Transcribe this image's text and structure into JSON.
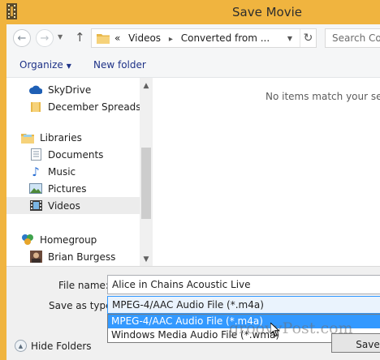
{
  "window": {
    "title": "Save Movie",
    "accent": "#f0b43f"
  },
  "navigation": {
    "back_icon": "back-arrow-icon",
    "forward_icon": "forward-arrow-icon",
    "up_icon": "up-arrow-icon"
  },
  "address": {
    "prefix": "«",
    "crumbs": [
      "Videos",
      "Converted from ..."
    ]
  },
  "search": {
    "placeholder": "Search Con"
  },
  "commands": {
    "organize": "Organize",
    "new_folder": "New folder"
  },
  "tree": {
    "items": [
      {
        "label": "SkyDrive",
        "icon": "skydrive-icon"
      },
      {
        "label": "December Spreadsheet",
        "icon": "folder-icon"
      },
      {
        "label": "Libraries",
        "icon": "libraries-icon"
      },
      {
        "label": "Documents",
        "icon": "documents-icon"
      },
      {
        "label": "Music",
        "icon": "music-icon"
      },
      {
        "label": "Pictures",
        "icon": "pictures-icon"
      },
      {
        "label": "Videos",
        "icon": "videos-icon",
        "selected": true
      },
      {
        "label": "Homegroup",
        "icon": "homegroup-icon"
      },
      {
        "label": "Brian Burgess",
        "icon": "user-avatar-icon"
      }
    ]
  },
  "content": {
    "empty_message": "No items match your search."
  },
  "form": {
    "filename_label": "File name:",
    "filename_value": "Alice in Chains Acoustic Live",
    "save_as_type_label": "Save as type:",
    "save_as_type_value": "MPEG-4/AAC Audio File (*.m4a)",
    "type_options": [
      "MPEG-4/AAC Audio File (*.m4a)",
      "Windows Media Audio File (*.wma)"
    ],
    "hide_folders": "Hide Folders",
    "save_button": "Save"
  },
  "watermark": "groovyPost.com"
}
